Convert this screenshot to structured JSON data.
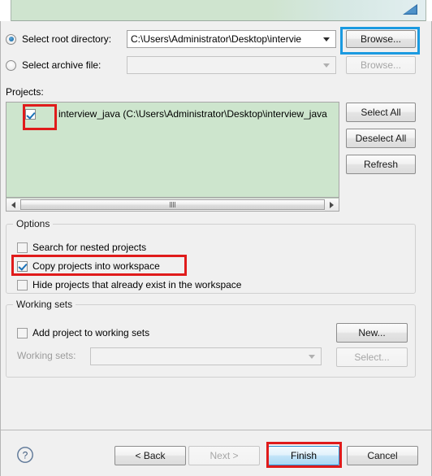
{
  "banner": {
    "icon": "import-wizard-arrow-icon"
  },
  "source": {
    "root_dir_radio_label": "Select root directory:",
    "root_dir_value": "C:\\Users\\Administrator\\Desktop\\intervie",
    "root_dir_selected": true,
    "archive_radio_label": "Select archive file:",
    "archive_value": "",
    "archive_selected": false,
    "browse_root_label": "Browse...",
    "browse_archive_label": "Browse..."
  },
  "projects": {
    "section_label": "Projects:",
    "items": [
      {
        "label": "interview_java (C:\\Users\\Administrator\\Desktop\\interview_java",
        "checked": true
      }
    ],
    "select_all_label": "Select All",
    "deselect_all_label": "Deselect All",
    "refresh_label": "Refresh",
    "list_background": "#cde5cd"
  },
  "options": {
    "title": "Options",
    "items": [
      {
        "label": "Search for nested projects",
        "checked": false
      },
      {
        "label": "Copy projects into workspace",
        "checked": true
      },
      {
        "label": "Hide projects that already exist in the workspace",
        "checked": false
      }
    ]
  },
  "working_sets": {
    "title": "Working sets",
    "add_checkbox_label": "Add project to working sets",
    "add_checked": false,
    "new_button_label": "New...",
    "working_sets_label": "Working sets:",
    "working_sets_value": "",
    "select_button_label": "Select..."
  },
  "footer": {
    "help_icon": "help-question-icon",
    "back_label": "< Back",
    "next_label": "Next >",
    "finish_label": "Finish",
    "cancel_label": "Cancel",
    "next_enabled": false,
    "finish_is_default": true
  },
  "annotations": {
    "highlight_color_red": "#e01b1b",
    "highlight_color_blue": "#1b9ae0"
  }
}
